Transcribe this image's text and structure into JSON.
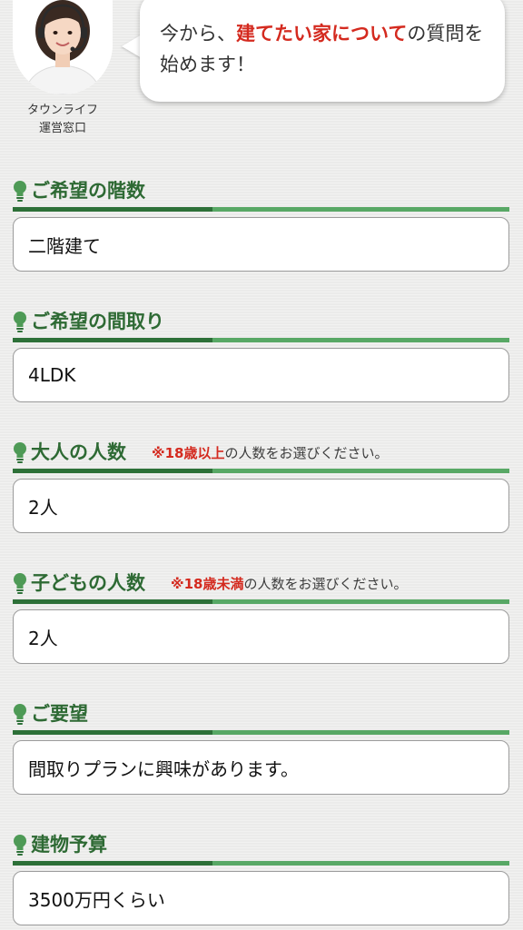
{
  "header": {
    "operator_name_line1": "タウンライフ",
    "operator_name_line2": "運営窓口",
    "bubble_text_before": "今から、",
    "bubble_text_highlight": "建てたい家について",
    "bubble_text_after": "の質問を始めます！"
  },
  "colors": {
    "accent_green_dark": "#2d7038",
    "accent_green_light": "#58a865",
    "highlight_red": "#d42a1f"
  },
  "sections": [
    {
      "title": "ご希望の階数",
      "icon": "lightbulb-icon",
      "value": "二階建て"
    },
    {
      "title": "ご希望の間取り",
      "icon": "lightbulb-icon",
      "value": "4LDK"
    },
    {
      "title": "大人の人数",
      "icon": "lightbulb-icon",
      "note_highlight": "※18歳以上",
      "note_rest": "の人数をお選びください。",
      "value": "2人"
    },
    {
      "title": "子どもの人数",
      "icon": "lightbulb-icon",
      "note_highlight": "※18歳未満",
      "note_rest": "の人数をお選びください。",
      "value": "2人"
    },
    {
      "title": "ご要望",
      "icon": "lightbulb-icon",
      "value": "間取りプランに興味があります。"
    },
    {
      "title": "建物予算",
      "icon": "lightbulb-icon",
      "value": "3500万円くらい"
    }
  ]
}
